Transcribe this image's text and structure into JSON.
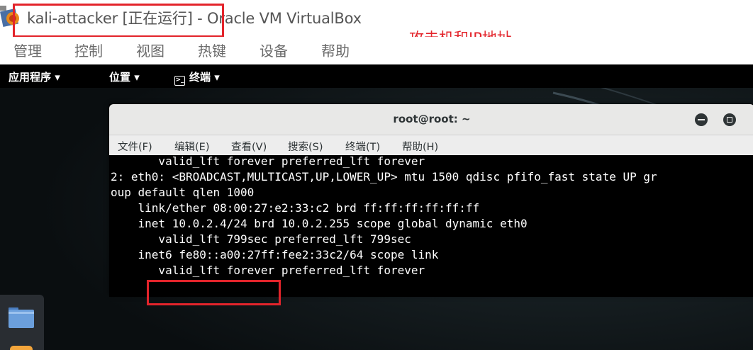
{
  "vbox": {
    "title": "kali-attacker [正在运行] - Oracle VM VirtualBox",
    "annotation": "攻击机和IP地址",
    "menu": [
      "管理",
      "控制",
      "视图",
      "热键",
      "设备",
      "帮助"
    ]
  },
  "guest": {
    "topbar": {
      "applications": "应用程序 ▾",
      "places": "位置 ▾",
      "terminal": "终端 ▾"
    }
  },
  "terminal": {
    "title": "root@root: ~",
    "menu": [
      "文件(F)",
      "编辑(E)",
      "查看(V)",
      "搜索(S)",
      "终端(T)",
      "帮助(H)"
    ],
    "lines": [
      "       valid_lft forever preferred_lft forever",
      "2: eth0: <BROADCAST,MULTICAST,UP,LOWER_UP> mtu 1500 qdisc pfifo_fast state UP gr",
      "oup default qlen 1000",
      "    link/ether 08:00:27:e2:33:c2 brd ff:ff:ff:ff:ff:ff",
      "    inet 10.0.2.4/24 brd 10.0.2.255 scope global dynamic eth0",
      "       valid_lft 799sec preferred_lft 799sec",
      "    inet6 fe80::a00:27ff:fee2:33c2/64 scope link",
      "       valid_lft forever preferred_lft forever"
    ]
  }
}
